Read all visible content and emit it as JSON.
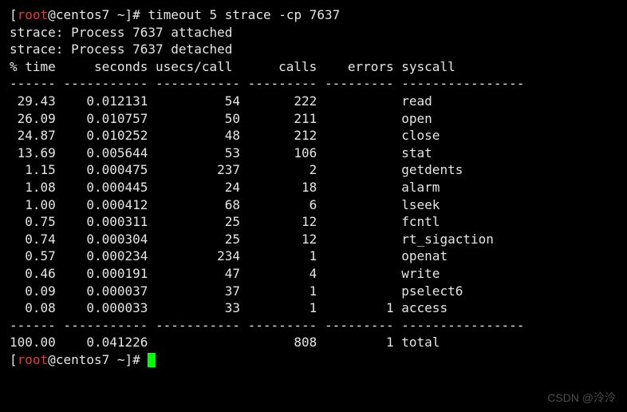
{
  "prompt": {
    "user": "root",
    "at": "@",
    "host": "centos7",
    "cwd": "~",
    "symbol": "#"
  },
  "command": "timeout 5 strace -cp 7637",
  "strace_lines": [
    "strace: Process 7637 attached",
    "strace: Process 7637 detached"
  ],
  "headers": {
    "pct_time": "% time",
    "seconds": "seconds",
    "usecs": "usecs/call",
    "calls": "calls",
    "errors": "errors",
    "syscall": "syscall"
  },
  "sep": {
    "c1": "------",
    "c2": "-----------",
    "c3": "-----------",
    "c4": "---------",
    "c5": "---------",
    "c6": "----------------"
  },
  "rows": [
    {
      "pct": "29.43",
      "sec": "0.012131",
      "usecs": "54",
      "calls": "222",
      "err": "",
      "sys": "read"
    },
    {
      "pct": "26.09",
      "sec": "0.010757",
      "usecs": "50",
      "calls": "211",
      "err": "",
      "sys": "open"
    },
    {
      "pct": "24.87",
      "sec": "0.010252",
      "usecs": "48",
      "calls": "212",
      "err": "",
      "sys": "close"
    },
    {
      "pct": "13.69",
      "sec": "0.005644",
      "usecs": "53",
      "calls": "106",
      "err": "",
      "sys": "stat"
    },
    {
      "pct": "1.15",
      "sec": "0.000475",
      "usecs": "237",
      "calls": "2",
      "err": "",
      "sys": "getdents"
    },
    {
      "pct": "1.08",
      "sec": "0.000445",
      "usecs": "24",
      "calls": "18",
      "err": "",
      "sys": "alarm"
    },
    {
      "pct": "1.00",
      "sec": "0.000412",
      "usecs": "68",
      "calls": "6",
      "err": "",
      "sys": "lseek"
    },
    {
      "pct": "0.75",
      "sec": "0.000311",
      "usecs": "25",
      "calls": "12",
      "err": "",
      "sys": "fcntl"
    },
    {
      "pct": "0.74",
      "sec": "0.000304",
      "usecs": "25",
      "calls": "12",
      "err": "",
      "sys": "rt_sigaction"
    },
    {
      "pct": "0.57",
      "sec": "0.000234",
      "usecs": "234",
      "calls": "1",
      "err": "",
      "sys": "openat"
    },
    {
      "pct": "0.46",
      "sec": "0.000191",
      "usecs": "47",
      "calls": "4",
      "err": "",
      "sys": "write"
    },
    {
      "pct": "0.09",
      "sec": "0.000037",
      "usecs": "37",
      "calls": "1",
      "err": "",
      "sys": "pselect6"
    },
    {
      "pct": "0.08",
      "sec": "0.000033",
      "usecs": "33",
      "calls": "1",
      "err": "1",
      "sys": "access"
    }
  ],
  "total": {
    "pct": "100.00",
    "sec": "0.041226",
    "usecs": "",
    "calls": "808",
    "err": "1",
    "sys": "total"
  },
  "watermark": "CSDN @泠泠"
}
